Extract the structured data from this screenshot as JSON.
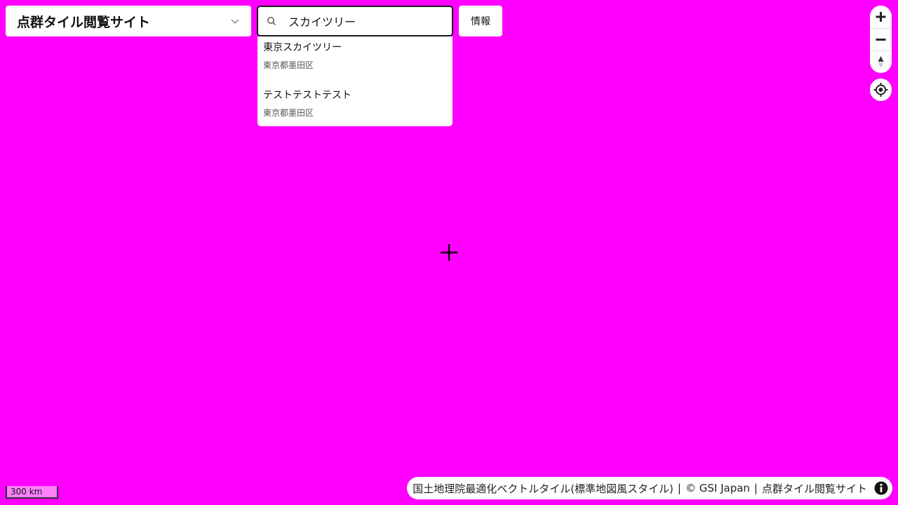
{
  "layer_selector": {
    "selected": "点群タイル閲覧サイト"
  },
  "search": {
    "value": "スカイツリー",
    "placeholder": "",
    "results": [
      {
        "title": "東京スカイツリー",
        "address": "東京都墨田区"
      },
      {
        "title": "テストテストテスト",
        "address": "東京都墨田区"
      }
    ]
  },
  "info_button": {
    "label": "情報"
  },
  "map": {
    "background_color": "#ff00ff"
  },
  "scale_bar": {
    "label": "300 km"
  },
  "attribution": {
    "source": "国土地理院最適化ベクトルタイル(標準地図風スタイル)",
    "separator": "|",
    "copyright": "© GSI Japan",
    "site": "点群タイル閲覧サイト"
  },
  "icons": {
    "chevron": "chevron-down-icon",
    "search": "search-icon",
    "zoom_in": "plus-icon",
    "zoom_out": "minus-icon",
    "compass": "compass-icon",
    "geolocate": "geolocate-icon",
    "crosshair": "crosshair-icon",
    "info": "info-icon"
  }
}
